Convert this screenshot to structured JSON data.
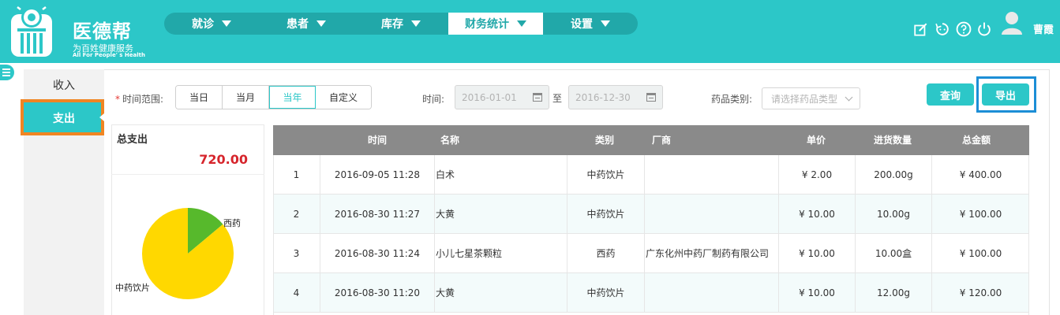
{
  "brand": {
    "name": "医德帮",
    "subtitle": "为百姓健康服务",
    "subtitle_en": "All For People' s Health"
  },
  "nav": {
    "items": [
      {
        "label": "就诊",
        "active": false
      },
      {
        "label": "患者",
        "active": false
      },
      {
        "label": "库存",
        "active": false
      },
      {
        "label": "财务统计",
        "active": true
      },
      {
        "label": "设置",
        "active": false
      }
    ]
  },
  "header_icons": [
    "edit-icon",
    "sync-icon",
    "help-icon",
    "power-icon"
  ],
  "user": {
    "name": "曹霞"
  },
  "sidebar": {
    "items": [
      {
        "label": "收入",
        "active": false
      },
      {
        "label": "支出",
        "active": true
      }
    ]
  },
  "filters": {
    "time_range_label": "时间范围:",
    "range_options": [
      "当日",
      "当月",
      "当年",
      "自定义"
    ],
    "range_selected": "当年",
    "time_label": "时间:",
    "date_from": "2016-01-01",
    "date_sep": "至",
    "date_to": "2016-12-30",
    "drug_type_label": "药品类别:",
    "drug_type_placeholder": "请选择药品类型"
  },
  "actions": {
    "query": "查询",
    "export": "导出"
  },
  "summary": {
    "title": "总支出",
    "value": "720.00"
  },
  "pie": {
    "slices": [
      {
        "label": "西药",
        "value": 100.0,
        "color": "#57b92c"
      },
      {
        "label": "中药饮片",
        "value": 620.0,
        "color": "#ffd800"
      }
    ]
  },
  "table": {
    "headers": [
      "",
      "时间",
      "名称",
      "类别",
      "厂商",
      "单价",
      "进货数量",
      "总金额"
    ],
    "rows": [
      [
        "1",
        "2016-09-05 11:28",
        "白术",
        "中药饮片",
        "",
        "¥ 2.00",
        "200.00g",
        "¥ 400.00"
      ],
      [
        "2",
        "2016-08-30 11:27",
        "大黄",
        "中药饮片",
        "",
        "¥ 10.00",
        "10.00g",
        "¥ 100.00"
      ],
      [
        "3",
        "2016-08-30 11:24",
        "小儿七星茶颗粒",
        "西药",
        "广东化州中药厂制药有限公司",
        "¥ 10.00",
        "10.00盒",
        "¥ 100.00"
      ],
      [
        "4",
        "2016-08-30 11:20",
        "大黄",
        "中药饮片",
        "",
        "¥ 10.00",
        "12.00g",
        "¥ 120.00"
      ]
    ]
  }
}
